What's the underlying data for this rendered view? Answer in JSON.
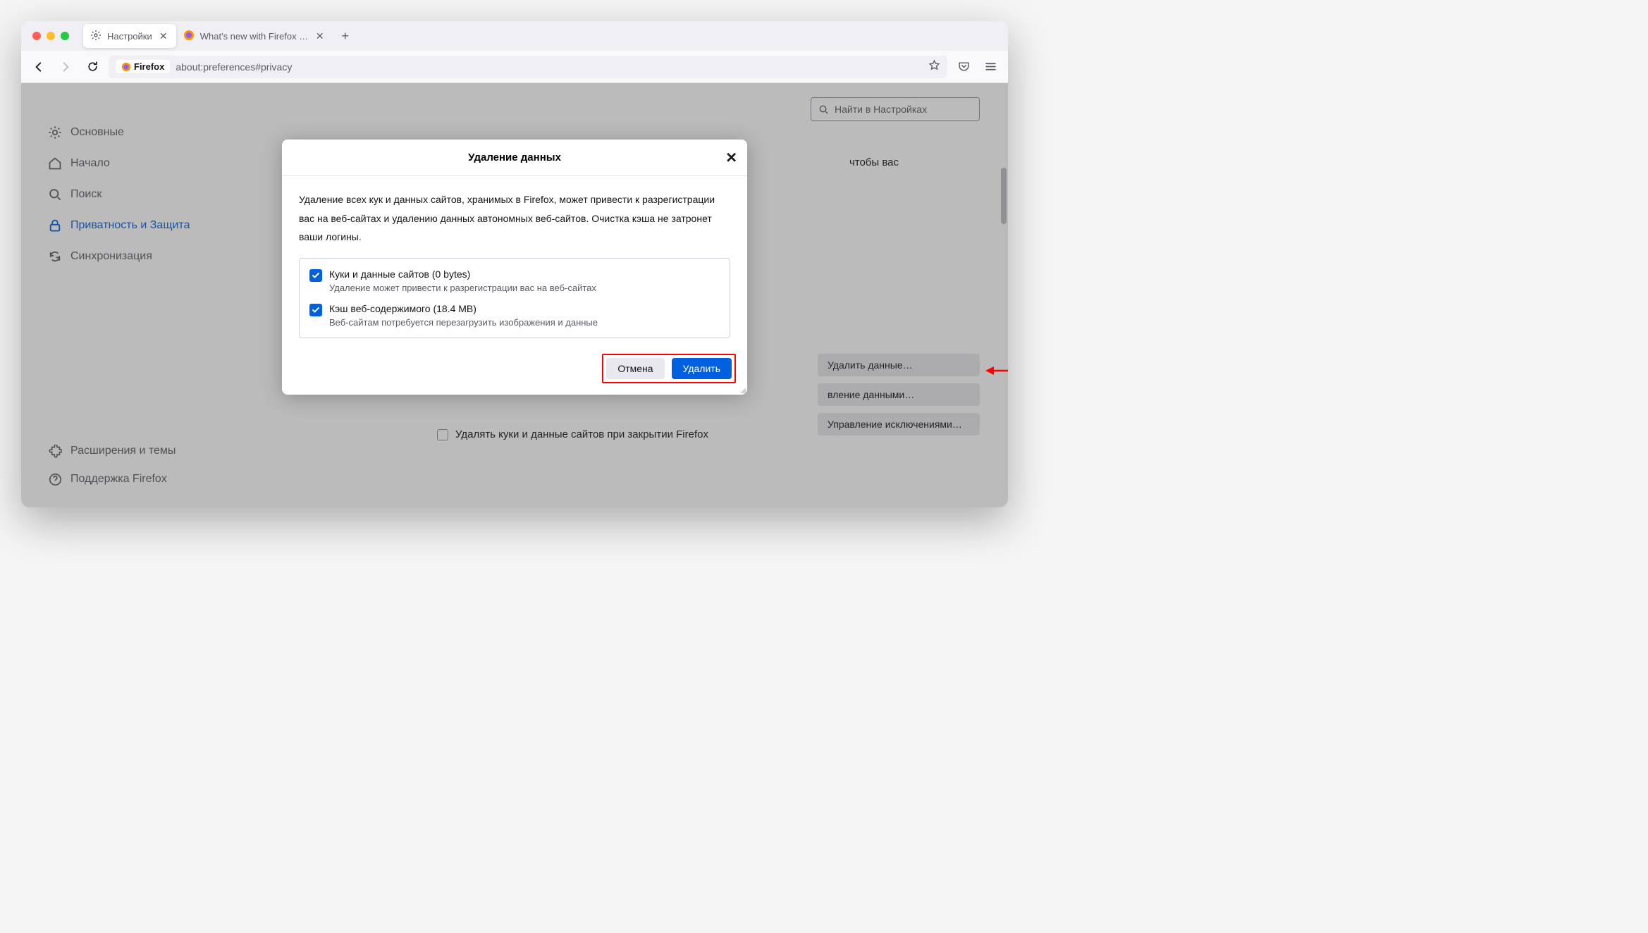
{
  "tabs": {
    "active": {
      "label": "Настройки"
    },
    "inactive": {
      "label": "What's new with Firefox - More priva"
    }
  },
  "urlbar": {
    "identity": "Firefox",
    "url": "about:preferences#privacy"
  },
  "sidebar": {
    "general": "Основные",
    "home": "Начало",
    "search": "Поиск",
    "privacy": "Приватность и Защита",
    "sync": "Синхронизация",
    "addons": "Расширения и темы",
    "support": "Поддержка Firefox"
  },
  "search_placeholder": "Найти в Настройках",
  "bg_text_fragment": "чтобы вас",
  "side_buttons": {
    "clear_data": "Удалить данные…",
    "manage_data": "вление данными…",
    "manage_exceptions": "Управление исключениями…"
  },
  "clear_on_close_label": "Удалять куки и данные сайтов при закрытии Firefox",
  "dialog": {
    "title": "Удаление данных",
    "description": "Удаление всех кук и данных сайтов, хранимых в Firefox, может привести к разрегистрации вас на веб-сайтах и удалению данных автономных веб-сайтов. Очистка кэша не затронет ваши логины.",
    "opt1_title": "Куки и данные сайтов (0 bytes)",
    "opt1_sub": "Удаление может привести к разрегистрации вас на веб-сайтах",
    "opt2_title": "Кэш веб-содержимого (18.4 MB)",
    "opt2_sub": "Веսайтам потребуется перезагрузить изображения и данные",
    "opt2_sub_fixed": "Веб-сайтам потребуется перезагрузить изображения и данные",
    "cancel": "Отмена",
    "confirm": "Удалить"
  }
}
